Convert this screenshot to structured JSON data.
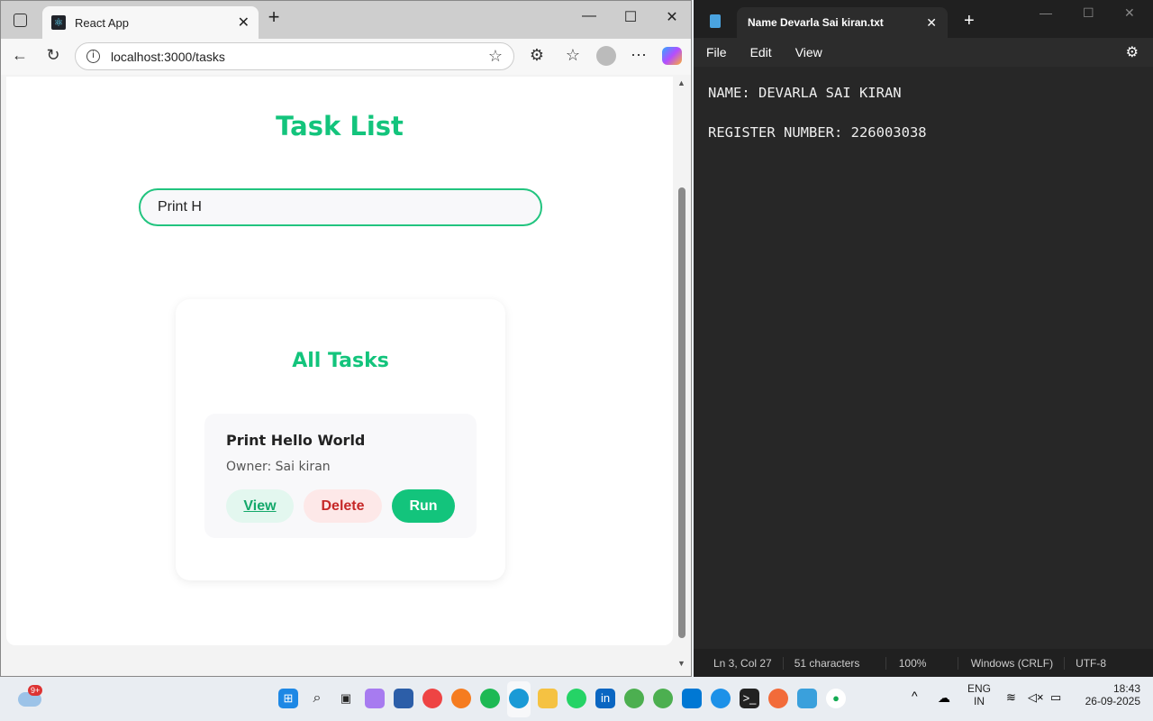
{
  "browser": {
    "tab_title": "React App",
    "url": "localhost:3000/tasks"
  },
  "page": {
    "title": "Task List",
    "search_value": "Print H",
    "section_title": "All Tasks",
    "tasks": [
      {
        "title": "Print Hello World",
        "owner": "Owner: Sai kiran",
        "view": "View",
        "delete": "Delete",
        "run": "Run"
      }
    ]
  },
  "notepad": {
    "tab_title": "Name Devarla Sai kiran.txt",
    "menu": [
      "File",
      "Edit",
      "View"
    ],
    "content": "NAME: DEVARLA SAI KIRAN\n\nREGISTER NUMBER: 226003038",
    "status": {
      "position": "Ln 3, Col 27",
      "chars": "51 characters",
      "zoom": "100%",
      "eol": "Windows (CRLF)",
      "encoding": "UTF-8"
    }
  },
  "taskbar": {
    "weather_badge": "9+",
    "lang1": "ENG",
    "lang2": "IN",
    "time": "18:43",
    "date": "26-09-2025"
  },
  "colors": {
    "accent": "#13c47c",
    "danger": "#c62828"
  }
}
